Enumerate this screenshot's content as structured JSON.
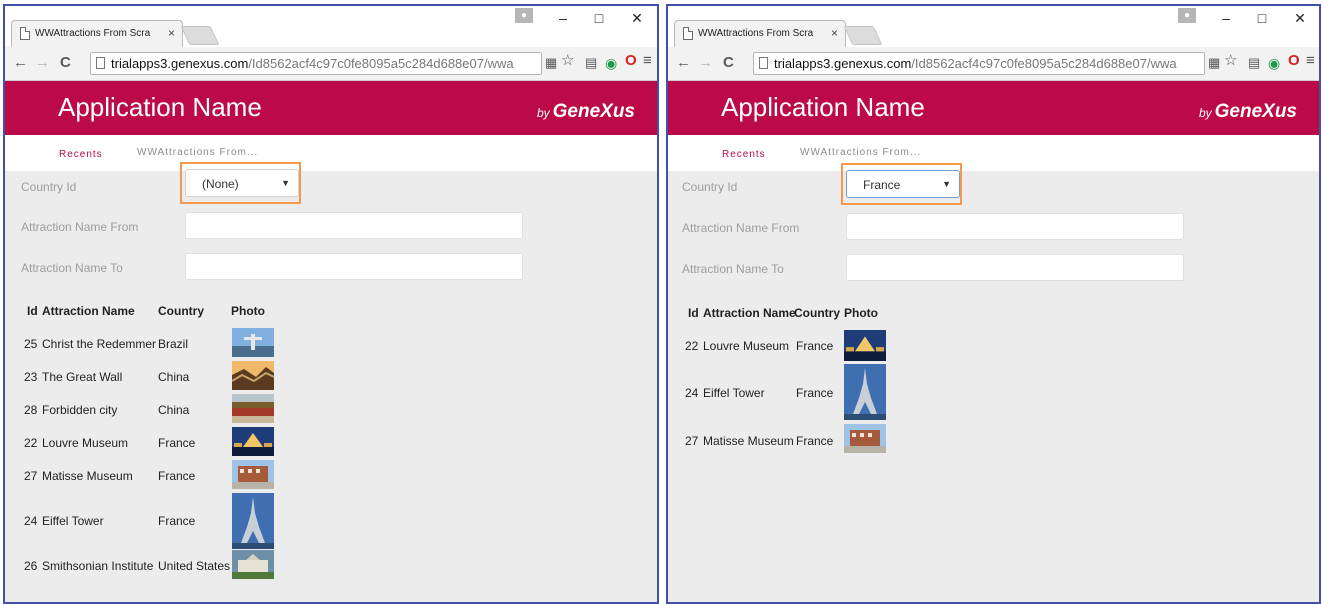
{
  "left": {
    "browser": {
      "tab_title": "WWAttractions From Scra",
      "tab_close": "×",
      "url_prefix": "trialapps3.genexus.com",
      "url_suffix": "/Id8562acf4c97c0fe8095a5c284d688e07/wwa"
    },
    "app": {
      "title": "Application Name",
      "brand_by": "by",
      "brand_name": "GeneXus"
    },
    "breadcrumb": {
      "recents": "Recents",
      "current": "WWAttractions From..."
    },
    "filters": {
      "country_label": "Country Id",
      "country_value": "(None)",
      "name_from_label": "Attraction Name From",
      "name_from_value": "",
      "name_to_label": "Attraction Name To",
      "name_to_value": ""
    },
    "grid": {
      "headers": [
        "Id",
        "Attraction Name",
        "Country",
        "Photo"
      ],
      "rows": [
        {
          "id": "25",
          "name": "Christ the Redemmer",
          "country": "Brazil",
          "photo": "christ-redeemer-photo"
        },
        {
          "id": "23",
          "name": "The Great Wall",
          "country": "China",
          "photo": "great-wall-photo"
        },
        {
          "id": "28",
          "name": "Forbidden city",
          "country": "China",
          "photo": "forbidden-city-photo"
        },
        {
          "id": "22",
          "name": "Louvre Museum",
          "country": "France",
          "photo": "louvre-photo"
        },
        {
          "id": "27",
          "name": "Matisse Museum",
          "country": "France",
          "photo": "matisse-museum-photo"
        },
        {
          "id": "24",
          "name": "Eiffel Tower",
          "country": "France",
          "photo": "eiffel-tower-photo"
        },
        {
          "id": "26",
          "name": "Smithsonian Institute",
          "country": "United States",
          "photo": "smithsonian-photo"
        }
      ]
    }
  },
  "right": {
    "browser": {
      "tab_title": "WWAttractions From Scra",
      "tab_close": "×",
      "url_prefix": "trialapps3.genexus.com",
      "url_suffix": "/Id8562acf4c97c0fe8095a5c284d688e07/wwa"
    },
    "app": {
      "title": "Application Name",
      "brand_by": "by",
      "brand_name": "GeneXus"
    },
    "breadcrumb": {
      "recents": "Recents",
      "current": "WWAttractions From..."
    },
    "filters": {
      "country_label": "Country Id",
      "country_value": "France",
      "name_from_label": "Attraction Name From",
      "name_from_value": "",
      "name_to_label": "Attraction Name To",
      "name_to_value": ""
    },
    "grid": {
      "headers": [
        "Id",
        "Attraction Name",
        "Country",
        "Photo"
      ],
      "rows": [
        {
          "id": "22",
          "name": "Louvre Museum",
          "country": "France",
          "photo": "louvre-photo"
        },
        {
          "id": "24",
          "name": "Eiffel Tower",
          "country": "France",
          "photo": "eiffel-tower-photo"
        },
        {
          "id": "27",
          "name": "Matisse Museum",
          "country": "France",
          "photo": "matisse-museum-photo"
        }
      ]
    }
  },
  "colors": {
    "brand": "#bb0a47",
    "focus": "#f39a4f",
    "window_border": "#3f51a8"
  }
}
